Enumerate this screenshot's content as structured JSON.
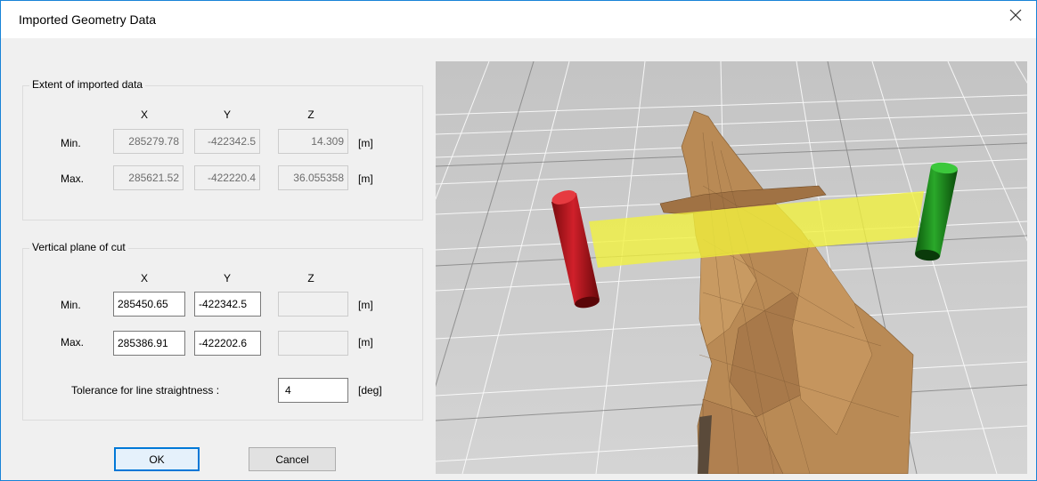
{
  "window": {
    "title": "Imported Geometry Data",
    "close_icon": "close-icon"
  },
  "extent": {
    "legend": "Extent of imported data",
    "headers": [
      "X",
      "Y",
      "Z"
    ],
    "min_label": "Min.",
    "max_label": "Max.",
    "min": {
      "x": "285279.78",
      "y": "-422342.5",
      "z": "14.309"
    },
    "max": {
      "x": "285621.52",
      "y": "-422220.4",
      "z": "36.055358"
    },
    "unit": "[m]"
  },
  "plane": {
    "legend": "Vertical plane of cut",
    "headers": [
      "X",
      "Y",
      "Z"
    ],
    "min_label": "Min.",
    "max_label": "Max.",
    "min": {
      "x": "285450.65",
      "y": "-422342.5",
      "z": ""
    },
    "max": {
      "x": "285386.91",
      "y": "-422202.6",
      "z": ""
    },
    "unit": "[m]",
    "tolerance_label": "Tolerance for line straightness :",
    "tolerance_value": "4",
    "tolerance_unit": "[deg]"
  },
  "buttons": {
    "ok": "OK",
    "cancel": "Cancel"
  },
  "colors": {
    "accent": "#0078d7",
    "viewport_bg": "#c8c8c8",
    "terrain": "#b98a55",
    "plane": "#f2f23c",
    "start_marker": "#c0161c",
    "end_marker": "#1c8a1c"
  }
}
